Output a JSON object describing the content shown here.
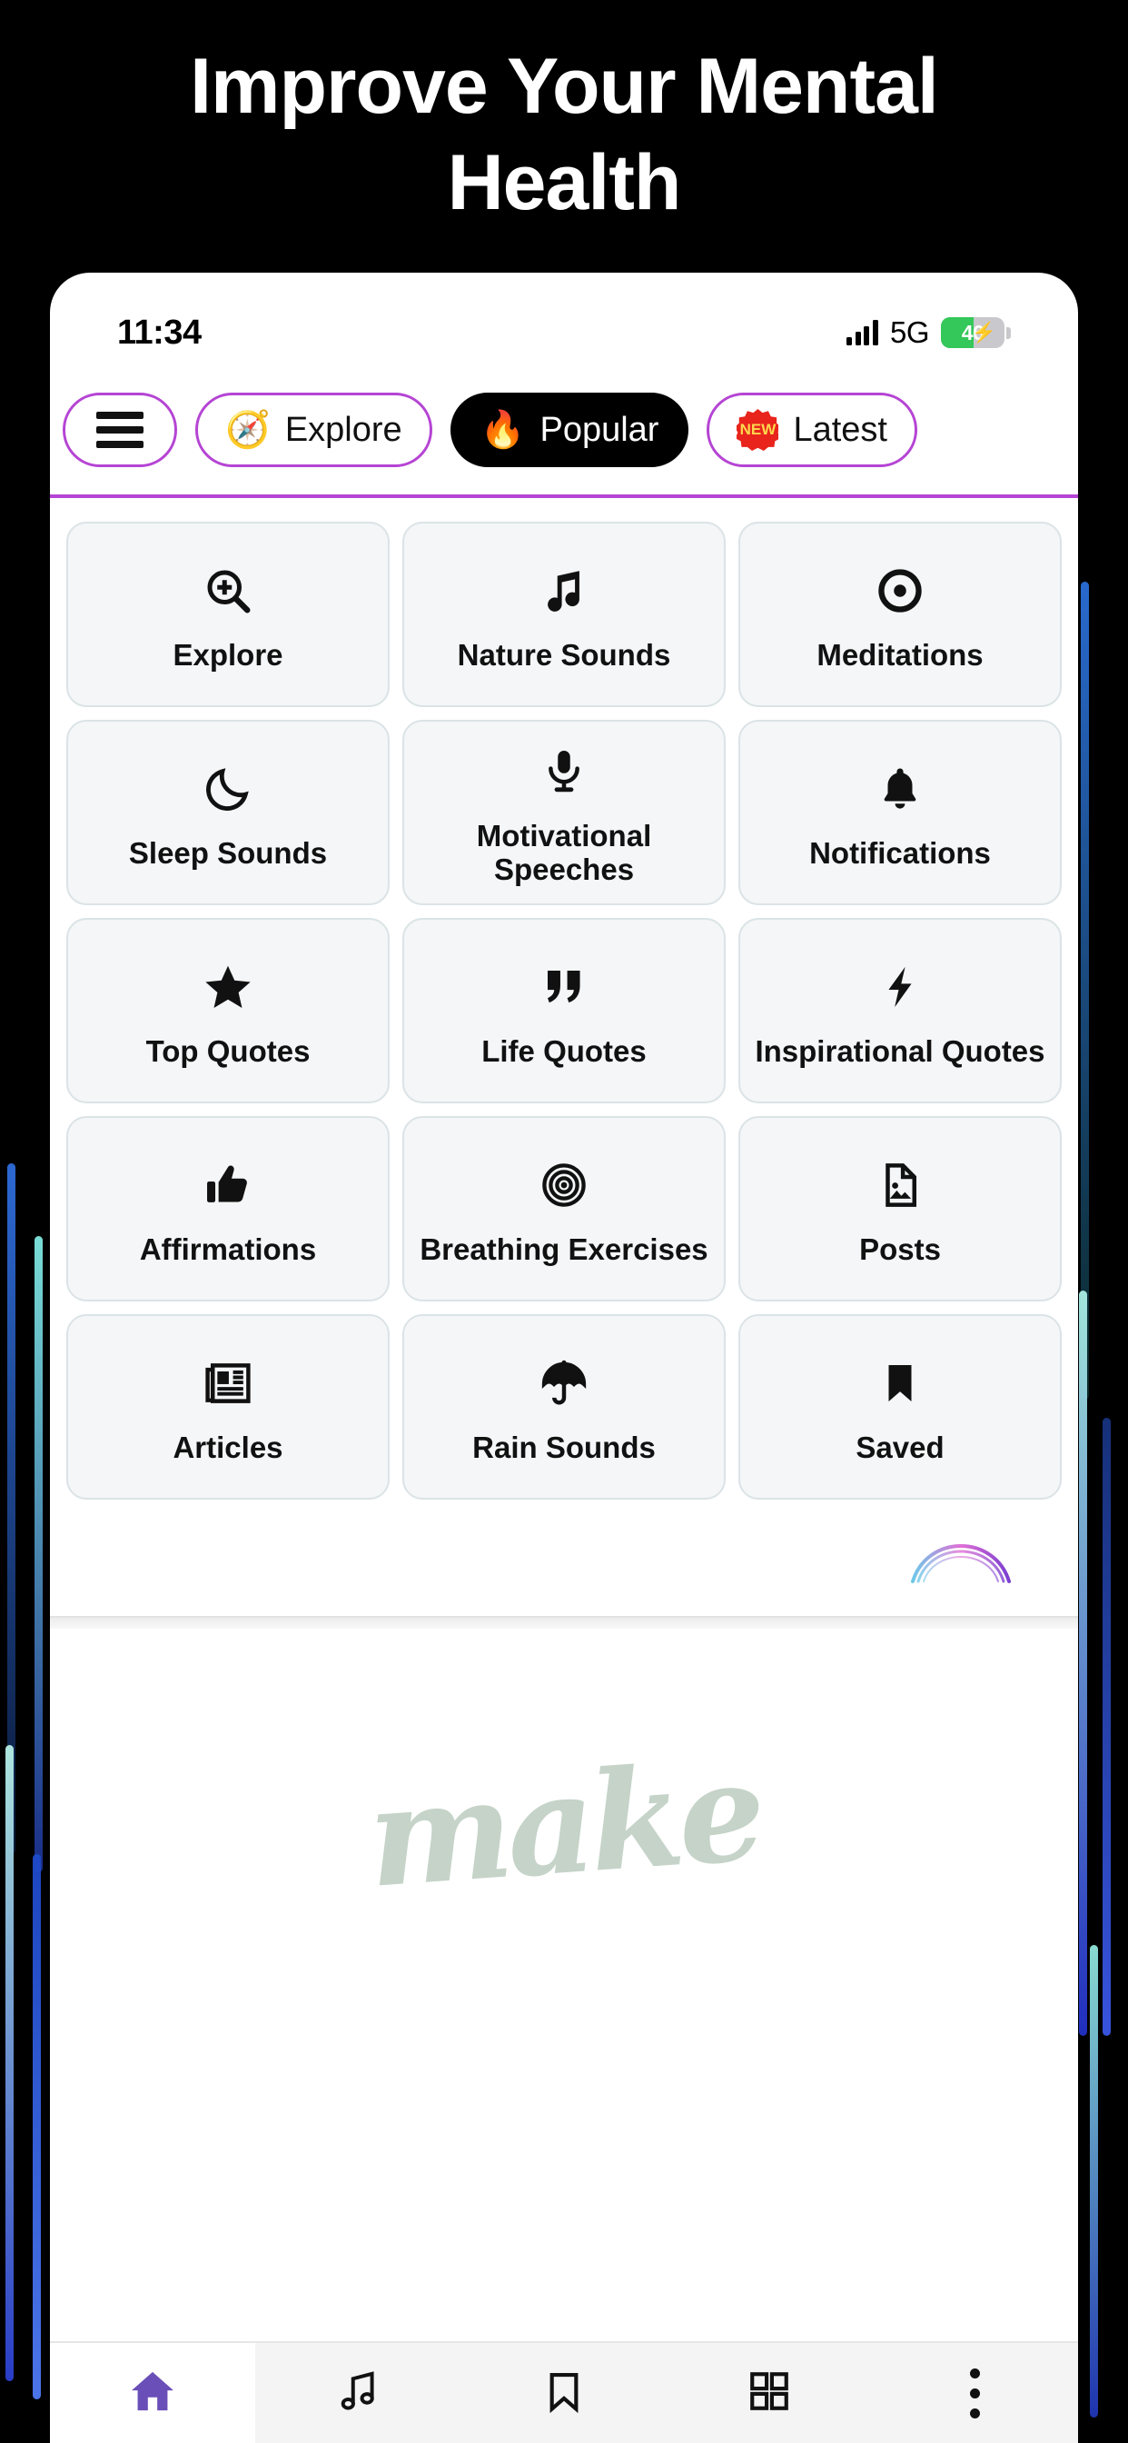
{
  "headline": {
    "line1": "Improve Your Mental",
    "line2": "Health"
  },
  "statusbar": {
    "time": "11:34",
    "signal_icon": "cellular-bars-icon",
    "network": "5G",
    "battery_level": "46",
    "battery_charging_icon": "charging-bolt-icon",
    "battery_color": "#34c759"
  },
  "tabs": {
    "accent_color": "#b544d4",
    "items": [
      {
        "label": "",
        "icon": "hamburger-menu-icon",
        "emoji": "",
        "active": false,
        "name": "menu"
      },
      {
        "label": "Explore",
        "icon": "compass-icon",
        "emoji": "🧭",
        "active": false,
        "name": "explore"
      },
      {
        "label": "Popular",
        "icon": "fire-icon",
        "emoji": "🔥",
        "active": true,
        "name": "popular"
      },
      {
        "label": "Latest",
        "icon": "new-badge-icon",
        "emoji": "NEW",
        "active": false,
        "name": "latest"
      }
    ]
  },
  "grid": {
    "tiles": [
      {
        "label": "Explore",
        "icon": "zoom-in-magnifier-icon"
      },
      {
        "label": "Nature Sounds",
        "icon": "music-note-icon"
      },
      {
        "label": "Meditations",
        "icon": "target-dot-icon"
      },
      {
        "label": "Sleep Sounds",
        "icon": "crescent-moon-icon"
      },
      {
        "label": "Motivational Speeches",
        "icon": "microphone-icon"
      },
      {
        "label": "Notifications",
        "icon": "bell-icon"
      },
      {
        "label": "Top Quotes",
        "icon": "star-icon"
      },
      {
        "label": "Life Quotes",
        "icon": "quote-marks-icon"
      },
      {
        "label": "Inspirational Quotes",
        "icon": "lightning-bolt-icon"
      },
      {
        "label": "Affirmations",
        "icon": "thumbs-up-icon"
      },
      {
        "label": "Breathing Exercises",
        "icon": "concentric-circles-icon"
      },
      {
        "label": "Posts",
        "icon": "image-file-icon"
      },
      {
        "label": "Articles",
        "icon": "newspaper-icon"
      },
      {
        "label": "Rain Sounds",
        "icon": "umbrella-icon"
      },
      {
        "label": "Saved",
        "icon": "bookmark-icon"
      }
    ]
  },
  "decor": {
    "arc_icon": "gradient-arc-icon",
    "watermark": "make",
    "watermark_color": "#c5d3c8"
  },
  "bottomnav": {
    "active_color": "#6b4fb8",
    "items": [
      {
        "icon": "home-icon",
        "active": true,
        "name": "home"
      },
      {
        "icon": "music-note-icon",
        "active": false,
        "name": "sounds"
      },
      {
        "icon": "bookmark-icon",
        "active": false,
        "name": "saved"
      },
      {
        "icon": "grid-icon",
        "active": false,
        "name": "categories"
      },
      {
        "icon": "more-vertical-icon",
        "active": false,
        "name": "more"
      }
    ]
  }
}
